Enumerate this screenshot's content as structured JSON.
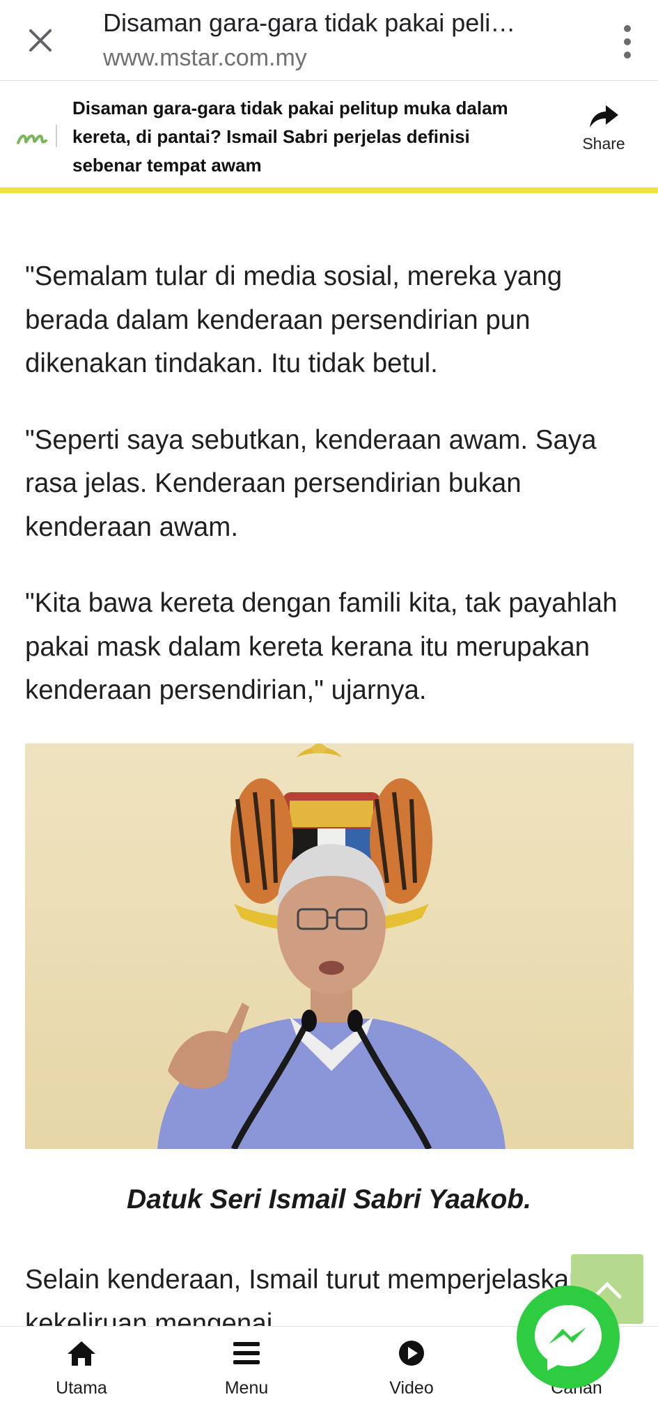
{
  "browser": {
    "tab_title": "Disaman gara-gara tidak pakai peli…",
    "url": "www.mstar.com.my"
  },
  "site_header": {
    "logo": "mstar-logo",
    "headline": "Disaman gara-gara tidak pakai pelitup muka dalam kereta, di pantai? Ismail Sabri perjelas definisi sebenar tempat awam",
    "share_label": "Share"
  },
  "article": {
    "paragraphs": [
      "\"Semalam tular di media sosial, mereka yang berada dalam kenderaan persendirian pun dikenakan tindakan. Itu tidak betul.",
      "\"Seperti saya sebutkan, kenderaan awam. Saya rasa jelas. Kenderaan persendirian bukan kenderaan awam.",
      "\"Kita bawa kereta dengan famili kita, tak payahlah pakai mask dalam kereta kerana itu merupakan kenderaan persendirian,\" ujarnya."
    ],
    "photo_caption": "Datuk Seri Ismail Sabri Yaakob.",
    "last_paragraph": "Selain kenderaan, Ismail turut memperjelaskan kekeliruan mengenai"
  },
  "bottom_nav": [
    {
      "label": "Utama",
      "icon": "home-icon"
    },
    {
      "label": "Menu",
      "icon": "hamburger-icon"
    },
    {
      "label": "Video",
      "icon": "play-icon"
    },
    {
      "label": "Carian",
      "icon": "search-icon"
    }
  ],
  "colors": {
    "header_accent": "#f2e03c",
    "logo_green": "#7ab55c",
    "messenger_green": "#2ecc40",
    "scroll_top_green": "#b5d98d"
  }
}
